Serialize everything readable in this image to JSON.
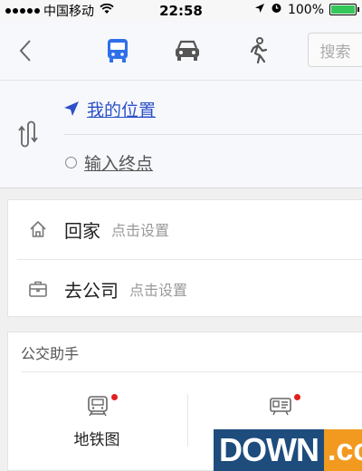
{
  "status_bar": {
    "carrier": "中国移动",
    "time": "22:58",
    "battery": "100%",
    "battery_level": 1.0
  },
  "header": {
    "back_icon": "chevron-left-icon",
    "modes": [
      {
        "name": "bus",
        "icon": "bus-icon",
        "active": true
      },
      {
        "name": "car",
        "icon": "car-icon",
        "active": false
      },
      {
        "name": "walk",
        "icon": "walk-icon",
        "active": false
      }
    ],
    "search_label": "搜索"
  },
  "route": {
    "start_label": "我的位置",
    "end_placeholder": "输入终点"
  },
  "favorites": {
    "home": {
      "title": "回家",
      "subtitle": "点击设置",
      "icon": "home-icon"
    },
    "work": {
      "title": "去公司",
      "subtitle": "点击设置",
      "icon": "briefcase-icon"
    }
  },
  "assistant": {
    "title": "公交助手",
    "tools": [
      {
        "label": "地铁图",
        "icon": "subway-map-icon",
        "badge": true
      },
      {
        "label": "",
        "icon": "ticket-icon",
        "badge": true
      }
    ]
  },
  "watermark": {
    "main": "DOWN",
    "suffix": ".cc"
  },
  "colors": {
    "accent_blue": "#2f6fea",
    "link_blue": "#2b50c8",
    "badge_red": "#e02020",
    "battery_green": "#34c759"
  }
}
